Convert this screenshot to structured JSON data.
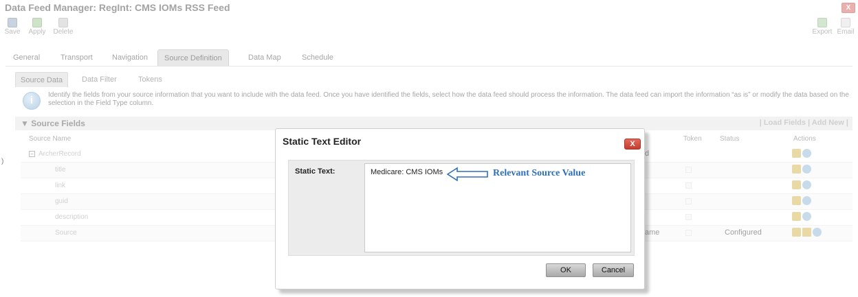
{
  "window": {
    "title": "Data Feed Manager: RegInt: CMS IOMs RSS Feed",
    "close_label": "X"
  },
  "toolbar": {
    "save": "Save",
    "apply": "Apply",
    "delete": "Delete",
    "export": "Export",
    "email": "Email"
  },
  "tabs": [
    "General",
    "Transport",
    "Navigation",
    "Source Definition",
    "Data Map",
    "Schedule"
  ],
  "active_tab": "Source Definition",
  "subtabs": [
    "Source Data",
    "Data Filter",
    "Tokens"
  ],
  "active_subtab": "Source Data",
  "info": {
    "text": "Identify the fields from your source information that you want to include with the data feed. Once you have identified the fields, select how the data feed should process the information. The data feed can import the information “as is” or modify the data based on the selection in the Field Type column."
  },
  "source_fields": {
    "title": "▼ Source Fields",
    "links": "| Load Fields | Add New |",
    "columns": {
      "source_name": "Source Name",
      "token": "Token",
      "status": "Status",
      "actions": "Actions"
    },
    "rows": [
      {
        "name": "ArcherRecord",
        "partial": "d",
        "status": ""
      },
      {
        "name": "title",
        "partial": "",
        "status": ""
      },
      {
        "name": "link",
        "partial": "",
        "status": ""
      },
      {
        "name": "guid",
        "partial": "",
        "status": ""
      },
      {
        "name": "description",
        "partial": "",
        "status": ""
      },
      {
        "name": "Source",
        "partial": "ame",
        "status": "Configured"
      }
    ]
  },
  "left_marker": ")",
  "modal": {
    "title": "Static Text Editor",
    "close_label": "X",
    "field_label": "Static Text:",
    "field_value": "Medicare: CMS IOMs",
    "annotation": "Relevant Source Value",
    "ok_label": "OK",
    "cancel_label": "Cancel",
    "annotation_color": "#2f6fb8"
  }
}
